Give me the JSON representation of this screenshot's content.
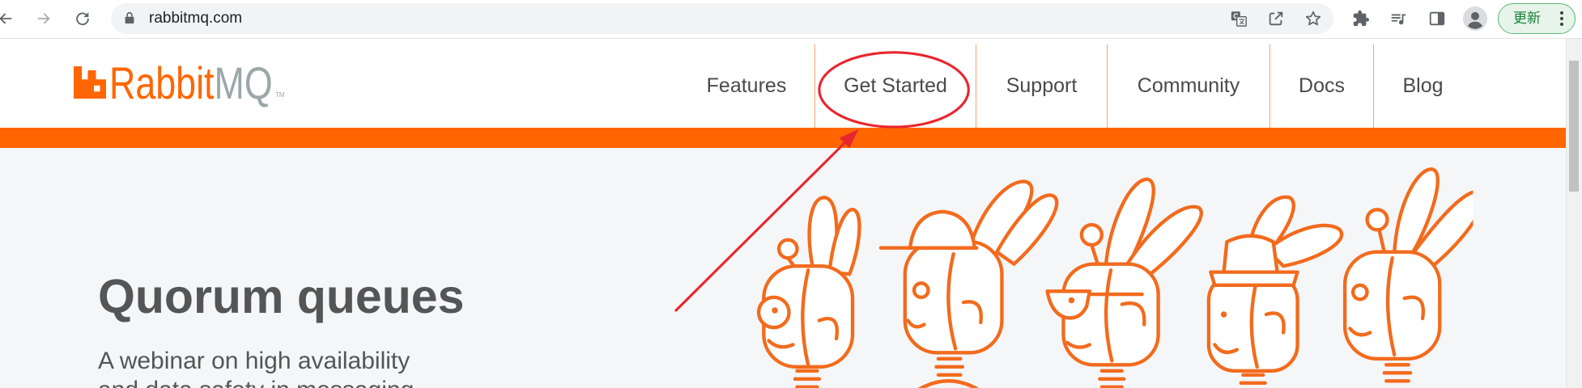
{
  "browser": {
    "url": "rabbitmq.com",
    "update_label": "更新",
    "toolbar_icons": [
      "back-arrow-icon",
      "forward-arrow-icon",
      "reload-icon",
      "lock-icon",
      "translate-icon",
      "share-icon",
      "bookmark-star-icon",
      "extensions-puzzle-icon",
      "media-queue-icon",
      "side-panel-icon",
      "profile-avatar-icon",
      "more-vert-icon"
    ]
  },
  "site": {
    "logo": {
      "rabbit": "Rabbit",
      "mq": "MQ",
      "tm": "TM"
    },
    "nav": [
      {
        "label": "Features"
      },
      {
        "label": "Get Started"
      },
      {
        "label": "Support"
      },
      {
        "label": "Community"
      },
      {
        "label": "Docs"
      },
      {
        "label": "Blog"
      }
    ]
  },
  "hero": {
    "title": "Quorum queues",
    "subtitle": [
      "A webinar on high availability",
      "and data safety in messaging"
    ]
  },
  "colors": {
    "brand_orange": "#ff6600",
    "nav_text": "#4a4a4a",
    "hero_text": "#555555",
    "hero_bg": "#f5f6f8",
    "annotation_red": "#e8262d",
    "update_green": "#188038"
  }
}
